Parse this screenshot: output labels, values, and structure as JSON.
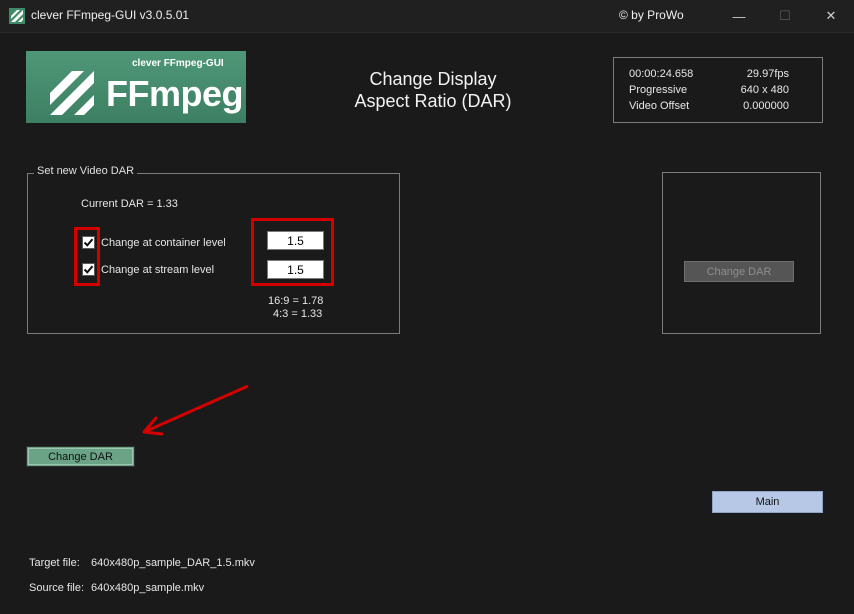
{
  "window": {
    "title": "clever FFmpeg-GUI v3.0.5.01",
    "credit": "© by ProWo",
    "minimize_glyph": "—",
    "maximize_glyph": "☐",
    "close_glyph": "✕"
  },
  "logo": {
    "subtitle": "clever FFmpeg-GUI",
    "name": "FFmpeg"
  },
  "heading": {
    "line1": "Change Display",
    "line2": "Aspect Ratio (DAR)"
  },
  "video_info": {
    "duration": "00:00:24.658",
    "fps": "29.97fps",
    "scan": "Progressive",
    "resolution": "640 x 480",
    "offset_label": "Video Offset",
    "offset_value": "0.000000"
  },
  "dar_group": {
    "title": "Set new Video DAR",
    "current": "Current DAR = 1.33",
    "container": {
      "label": "Change at container level",
      "checked": true,
      "value": "1.5"
    },
    "stream": {
      "label": "Change at stream level",
      "checked": true,
      "value": "1.5"
    },
    "note_169": "16:9 = 1.78",
    "note_43": "4:3 = 1.33"
  },
  "buttons": {
    "change_dar_disabled": "Change DAR",
    "change_dar": "Change DAR",
    "main": "Main"
  },
  "files": {
    "target_label": "Target file:",
    "target_value": "640x480p_sample_DAR_1.5.mkv",
    "source_label": "Source file:",
    "source_value": "640x480p_sample.mkv"
  },
  "colors": {
    "background": "#1a1a1a",
    "logo_green": "#4f9778",
    "button_green": "#6aa386",
    "main_button": "#b6c8e6",
    "highlight_red": "#d40000"
  }
}
